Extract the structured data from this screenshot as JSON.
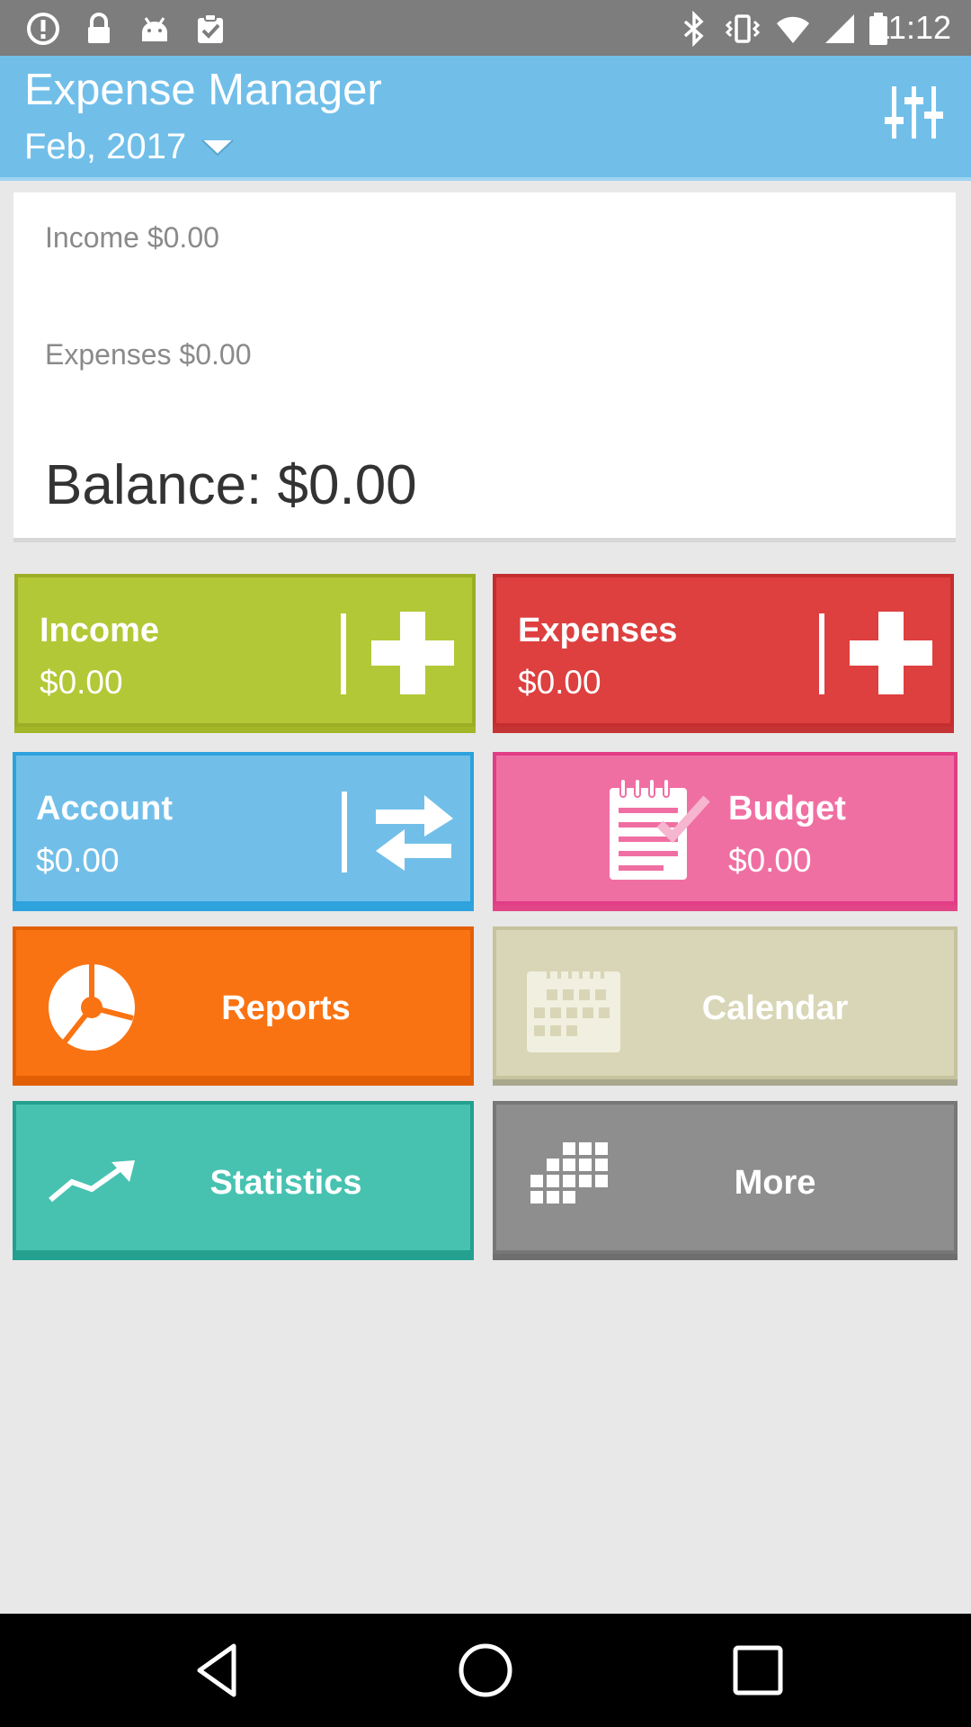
{
  "status_bar": {
    "time": "11:12",
    "icons": [
      "alert-icon",
      "lock-icon",
      "android-icon",
      "clipboard-check-icon",
      "bluetooth-icon",
      "vibrate-icon",
      "wifi-icon",
      "signal-icon",
      "battery-icon"
    ]
  },
  "header": {
    "title": "Expense Manager",
    "month": "Feb, 2017",
    "settings_icon": "sliders-icon",
    "background_color": "#71bfe9"
  },
  "summary": {
    "income": "Income $0.00",
    "expenses": "Expenses $0.00",
    "balance": "Balance: $0.00"
  },
  "tiles": {
    "income": {
      "title": "Income",
      "amount": "$0.00",
      "icon": "plus-icon",
      "color": "#b3c836"
    },
    "expenses": {
      "title": "Expenses",
      "amount": "$0.00",
      "icon": "plus-icon",
      "color": "#de3f3f"
    },
    "account": {
      "title": "Account",
      "amount": "$0.00",
      "icon": "transfer-arrows-icon",
      "color": "#71bfe9"
    },
    "budget": {
      "title": "Budget",
      "amount": "$0.00",
      "icon": "notepad-check-icon",
      "color": "#f06fa3"
    },
    "reports": {
      "title": "Reports",
      "icon": "pie-chart-icon",
      "color": "#fa7313"
    },
    "calendar": {
      "title": "Calendar",
      "icon": "calendar-icon",
      "color": "#d8d6b6"
    },
    "statistics": {
      "title": "Statistics",
      "icon": "trend-line-icon",
      "color": "#47c2b1"
    },
    "more": {
      "title": "More",
      "icon": "grid-icon",
      "color": "#8e8e8e"
    }
  },
  "nav_bar": {
    "buttons": [
      "back-icon",
      "home-icon",
      "recents-icon"
    ]
  }
}
